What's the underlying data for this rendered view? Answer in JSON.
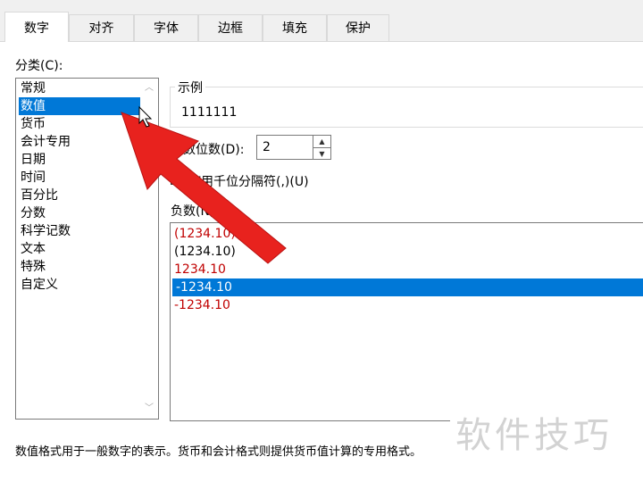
{
  "tabs": [
    {
      "label": "数字",
      "active": true
    },
    {
      "label": "对齐"
    },
    {
      "label": "字体"
    },
    {
      "label": "边框"
    },
    {
      "label": "填充"
    },
    {
      "label": "保护"
    }
  ],
  "category_label": "分类(C):",
  "categories": [
    "常规",
    "数值",
    "货币",
    "会计专用",
    "日期",
    "时间",
    "百分比",
    "分数",
    "科学记数",
    "文本",
    "特殊",
    "自定义"
  ],
  "selected_category": "数值",
  "sample": {
    "label": "示例",
    "value": "1111111"
  },
  "decimal": {
    "label": "小数位数(D):",
    "value": "2"
  },
  "thousands": {
    "label": "使用千位分隔符(,)(U)",
    "checked": false
  },
  "negative": {
    "label": "负数(N):",
    "items": [
      {
        "text": "(1234.10)",
        "color": "#c00000"
      },
      {
        "text": "(1234.10)",
        "color": "#000000"
      },
      {
        "text": "1234.10",
        "color": "#c00000"
      },
      {
        "text": "-1234.10",
        "color": "#000000",
        "selected": true
      },
      {
        "text": "-1234.10",
        "color": "#c00000"
      }
    ]
  },
  "description": "数值格式用于一般数字的表示。货币和会计格式则提供货币值计算的专用格式。",
  "watermark": "软件技巧",
  "colors": {
    "accent": "#0078d7",
    "arrow": "#e8221e"
  }
}
